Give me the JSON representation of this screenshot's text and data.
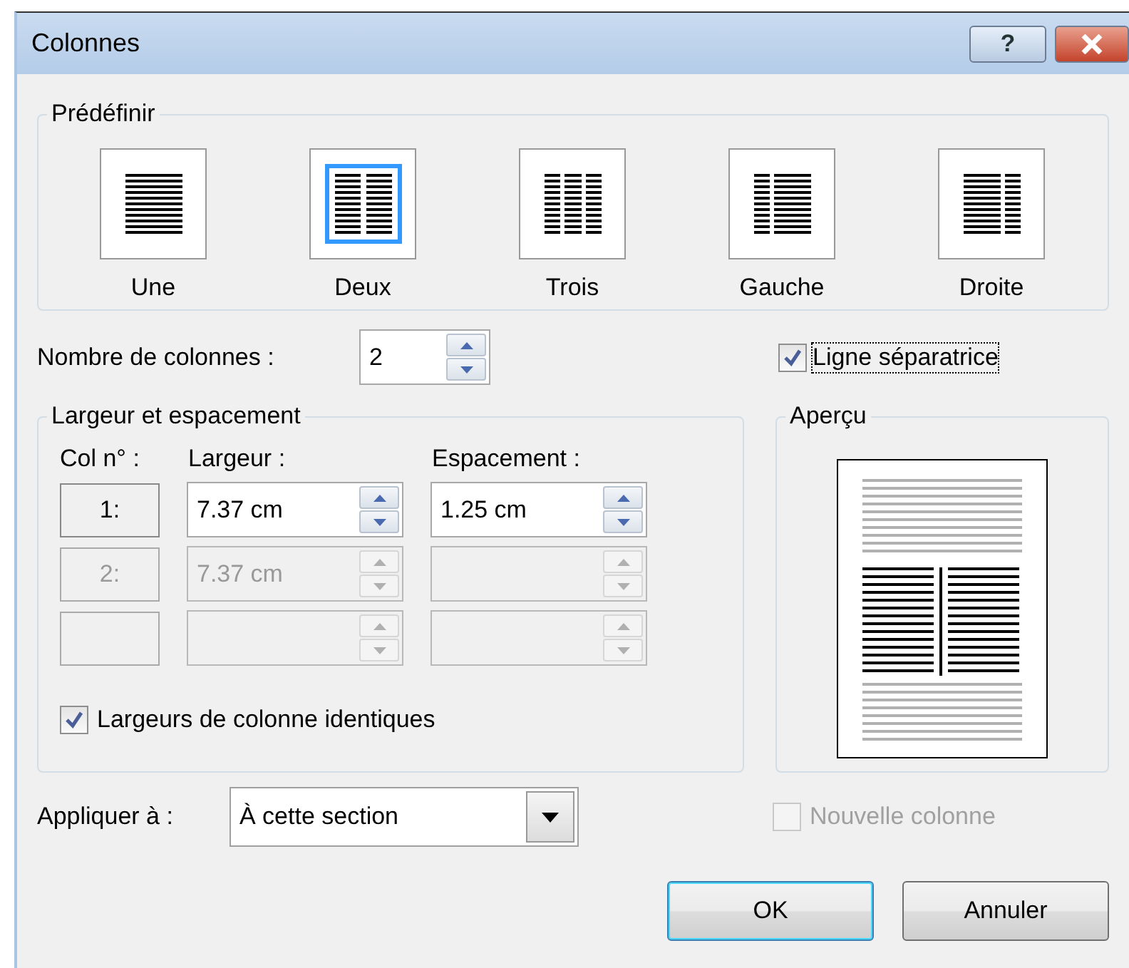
{
  "window": {
    "title": "Colonnes"
  },
  "title_buttons": [
    {
      "kind": "help",
      "label": "?"
    },
    {
      "kind": "close"
    }
  ],
  "presets": {
    "title": "Prédéfinir",
    "items": [
      {
        "label": "Une",
        "kind": "one",
        "selected": false
      },
      {
        "label": "Deux",
        "kind": "two",
        "selected": true
      },
      {
        "label": "Trois",
        "kind": "three",
        "selected": false
      },
      {
        "label": "Gauche",
        "kind": "left",
        "selected": false
      },
      {
        "label": "Droite",
        "kind": "right",
        "selected": false
      }
    ]
  },
  "columns_count": {
    "label": "Nombre de colonnes :",
    "value": "2"
  },
  "separator_line": {
    "label": "Ligne séparatrice",
    "checked": true,
    "focused": true
  },
  "width_spacing": {
    "title": "Largeur et espacement",
    "headers": [
      "Col n° :",
      "Largeur :",
      "Espacement :"
    ],
    "rows": [
      {
        "number": "1:",
        "width": "7.37 cm",
        "spacing": "1.25 cm",
        "disabled": false
      },
      {
        "number": "2:",
        "width": "7.37 cm",
        "disabled": true
      },
      {
        "disabled": true
      }
    ],
    "equal_widths": {
      "label": "Largeurs de colonne identiques",
      "checked": true
    }
  },
  "preview": {
    "title": "Aperçu"
  },
  "apply_to": {
    "label": "Appliquer à :",
    "value": "À cette section"
  },
  "new_column": {
    "label": "Nouvelle colonne",
    "checked": false,
    "disabled": true
  },
  "buttons": [
    {
      "label": "OK",
      "default": true
    },
    {
      "label": "Annuler",
      "default": false
    }
  ]
}
